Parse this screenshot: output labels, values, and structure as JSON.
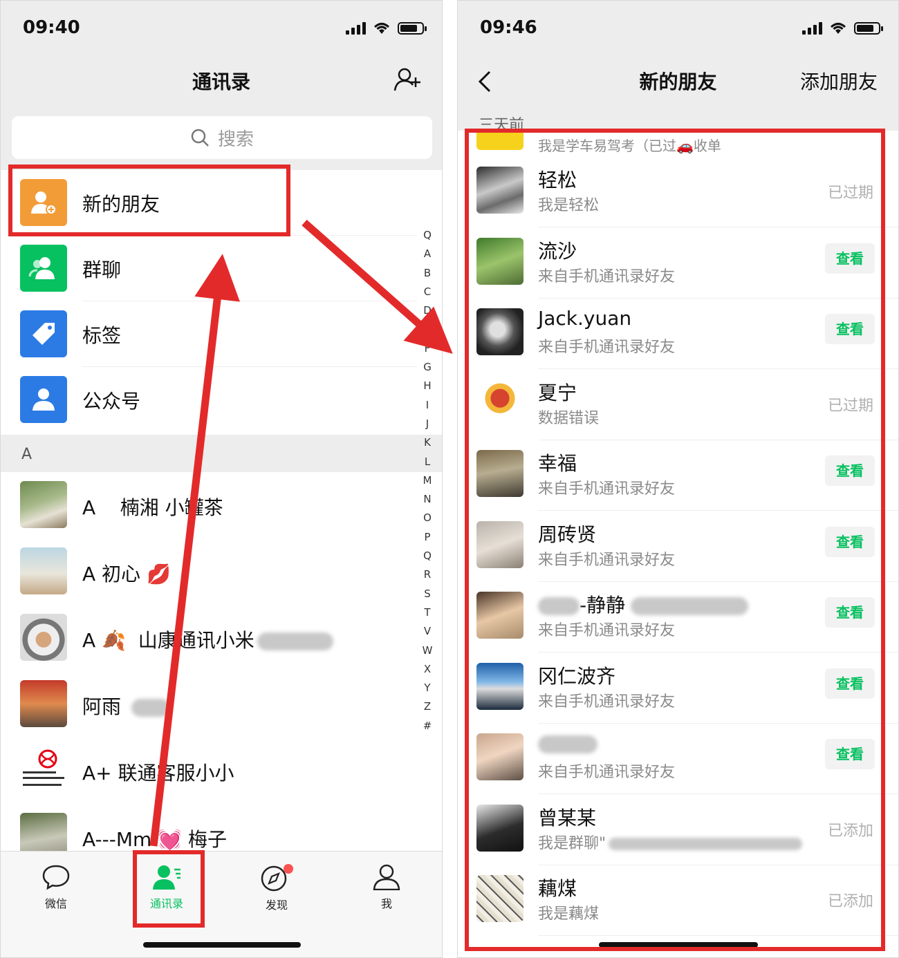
{
  "left": {
    "status": {
      "time": "09:40"
    },
    "title": "通讯录",
    "search_placeholder": "搜索",
    "functions": [
      {
        "label": "新的朋友",
        "icon": "new-friend-icon",
        "color": "#f29c37"
      },
      {
        "label": "群聊",
        "icon": "group-chat-icon",
        "color": "#07c160"
      },
      {
        "label": "标签",
        "icon": "tag-icon",
        "color": "#2c7be5"
      },
      {
        "label": "公众号",
        "icon": "official-account-icon",
        "color": "#2c7be5"
      }
    ],
    "section": "A",
    "contacts": [
      {
        "name_a": "A",
        "name_b": "楠湘 小罐茶"
      },
      {
        "name_a": "A 初心",
        "name_b": "💋"
      },
      {
        "name_a": "A",
        "name_b": "山康通讯小米"
      },
      {
        "name_a": "阿雨",
        "name_b": ""
      },
      {
        "name_a": "A+ 联通客服小小",
        "name_b": ""
      },
      {
        "name_a": "A---Mm",
        "name_b": "💓 梅子"
      }
    ],
    "index": [
      "Q",
      "A",
      "B",
      "C",
      "D",
      "E",
      "F",
      "G",
      "H",
      "I",
      "J",
      "K",
      "L",
      "M",
      "N",
      "O",
      "P",
      "Q",
      "R",
      "S",
      "T",
      "V",
      "W",
      "X",
      "Y",
      "Z",
      "#"
    ],
    "tabs": [
      {
        "label": "微信",
        "icon": "chat-icon"
      },
      {
        "label": "通讯录",
        "icon": "contacts-icon"
      },
      {
        "label": "发现",
        "icon": "discover-icon"
      },
      {
        "label": "我",
        "icon": "me-icon"
      }
    ]
  },
  "right": {
    "status": {
      "time": "09:46"
    },
    "title": "新的朋友",
    "add_friend": "添加朋友",
    "day_header": "三天前",
    "partial_text": "我是学车易驾考（已过🚗收单",
    "requests": [
      {
        "name": "轻松",
        "sub": "我是轻松",
        "status": "已过期",
        "type": "text"
      },
      {
        "name": "流沙",
        "sub": "来自手机通讯录好友",
        "status": "查看",
        "type": "button"
      },
      {
        "name": "Jack.yuan",
        "sub": "来自手机通讯录好友",
        "status": "查看",
        "type": "button"
      },
      {
        "name": "夏宁",
        "sub": "数据错误",
        "status": "已过期",
        "type": "text"
      },
      {
        "name": "幸福",
        "sub": "来自手机通讯录好友",
        "status": "查看",
        "type": "button"
      },
      {
        "name": "周砖贤",
        "sub": "来自手机通讯录好友",
        "status": "查看",
        "type": "button"
      },
      {
        "name": "-静静",
        "sub": "来自手机通讯录好友",
        "status": "查看",
        "type": "button"
      },
      {
        "name": "冈仁波齐",
        "sub": "来自手机通讯录好友",
        "status": "查看",
        "type": "button"
      },
      {
        "name": "",
        "sub": "来自手机通讯录好友",
        "status": "查看",
        "type": "button"
      },
      {
        "name": "曾某某",
        "sub": "我是群聊\"",
        "status": "已添加",
        "type": "text"
      },
      {
        "name": "藕煤",
        "sub": "我是藕煤",
        "status": "已添加",
        "type": "text"
      }
    ]
  },
  "colors": {
    "accent_green": "#07c160",
    "highlight_red": "#e32a2a"
  }
}
